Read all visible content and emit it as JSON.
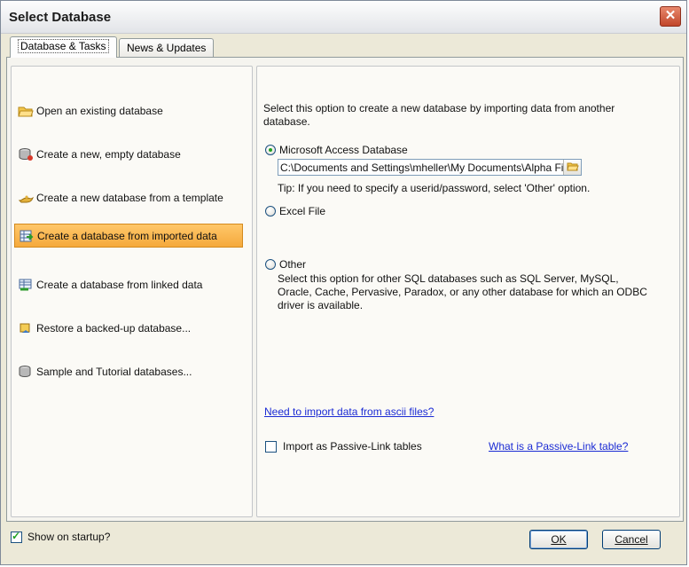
{
  "window": {
    "title": "Select Database"
  },
  "tabs": [
    {
      "label": "Database & Tasks",
      "active": true
    },
    {
      "label": "News & Updates",
      "active": false
    }
  ],
  "tasks": [
    {
      "label": "Open an existing database",
      "icon": "folder-open-icon"
    },
    {
      "label": "Create a new, empty database",
      "icon": "database-icon"
    },
    {
      "label": "Create a new database from a template",
      "icon": "magic-lamp-icon"
    },
    {
      "label": "Create a database from imported data",
      "icon": "import-data-icon",
      "selected": true
    },
    {
      "label": "Create a database from linked data",
      "icon": "linked-data-icon"
    },
    {
      "label": "Restore a backed-up database...",
      "icon": "restore-icon"
    },
    {
      "label": "Sample and Tutorial databases...",
      "icon": "database-icon"
    }
  ],
  "right": {
    "intro": "Select this option to create a new database by importing data from another database.",
    "options": {
      "access": {
        "label": "Microsoft Access Database",
        "checked": true
      },
      "path_value": "C:\\Documents and Settings\\mheller\\My Documents\\Alpha Five",
      "tip": "Tip: If you need to specify a userid/password, select 'Other' option.",
      "excel": {
        "label": "Excel File",
        "checked": false
      },
      "other": {
        "label": "Other",
        "checked": false
      },
      "other_desc": "Select this option for other SQL databases such as SQL Server, MySQL, Oracle, Cache, Pervasive, Paradox, or any other database for which an ODBC driver is available."
    },
    "ascii_link": "Need to import data from ascii files?",
    "passive_checkbox_label": "Import as Passive-Link tables",
    "passive_checked": false,
    "passive_link": "What is a Passive-Link table?"
  },
  "footer": {
    "show_startup_label": "Show on startup?",
    "show_startup_checked": true,
    "ok_label": "OK",
    "cancel_label": "Cancel"
  },
  "colors": {
    "selection": "#f5a93c",
    "link": "#1b2bd4",
    "radio_dot": "#21a121"
  }
}
